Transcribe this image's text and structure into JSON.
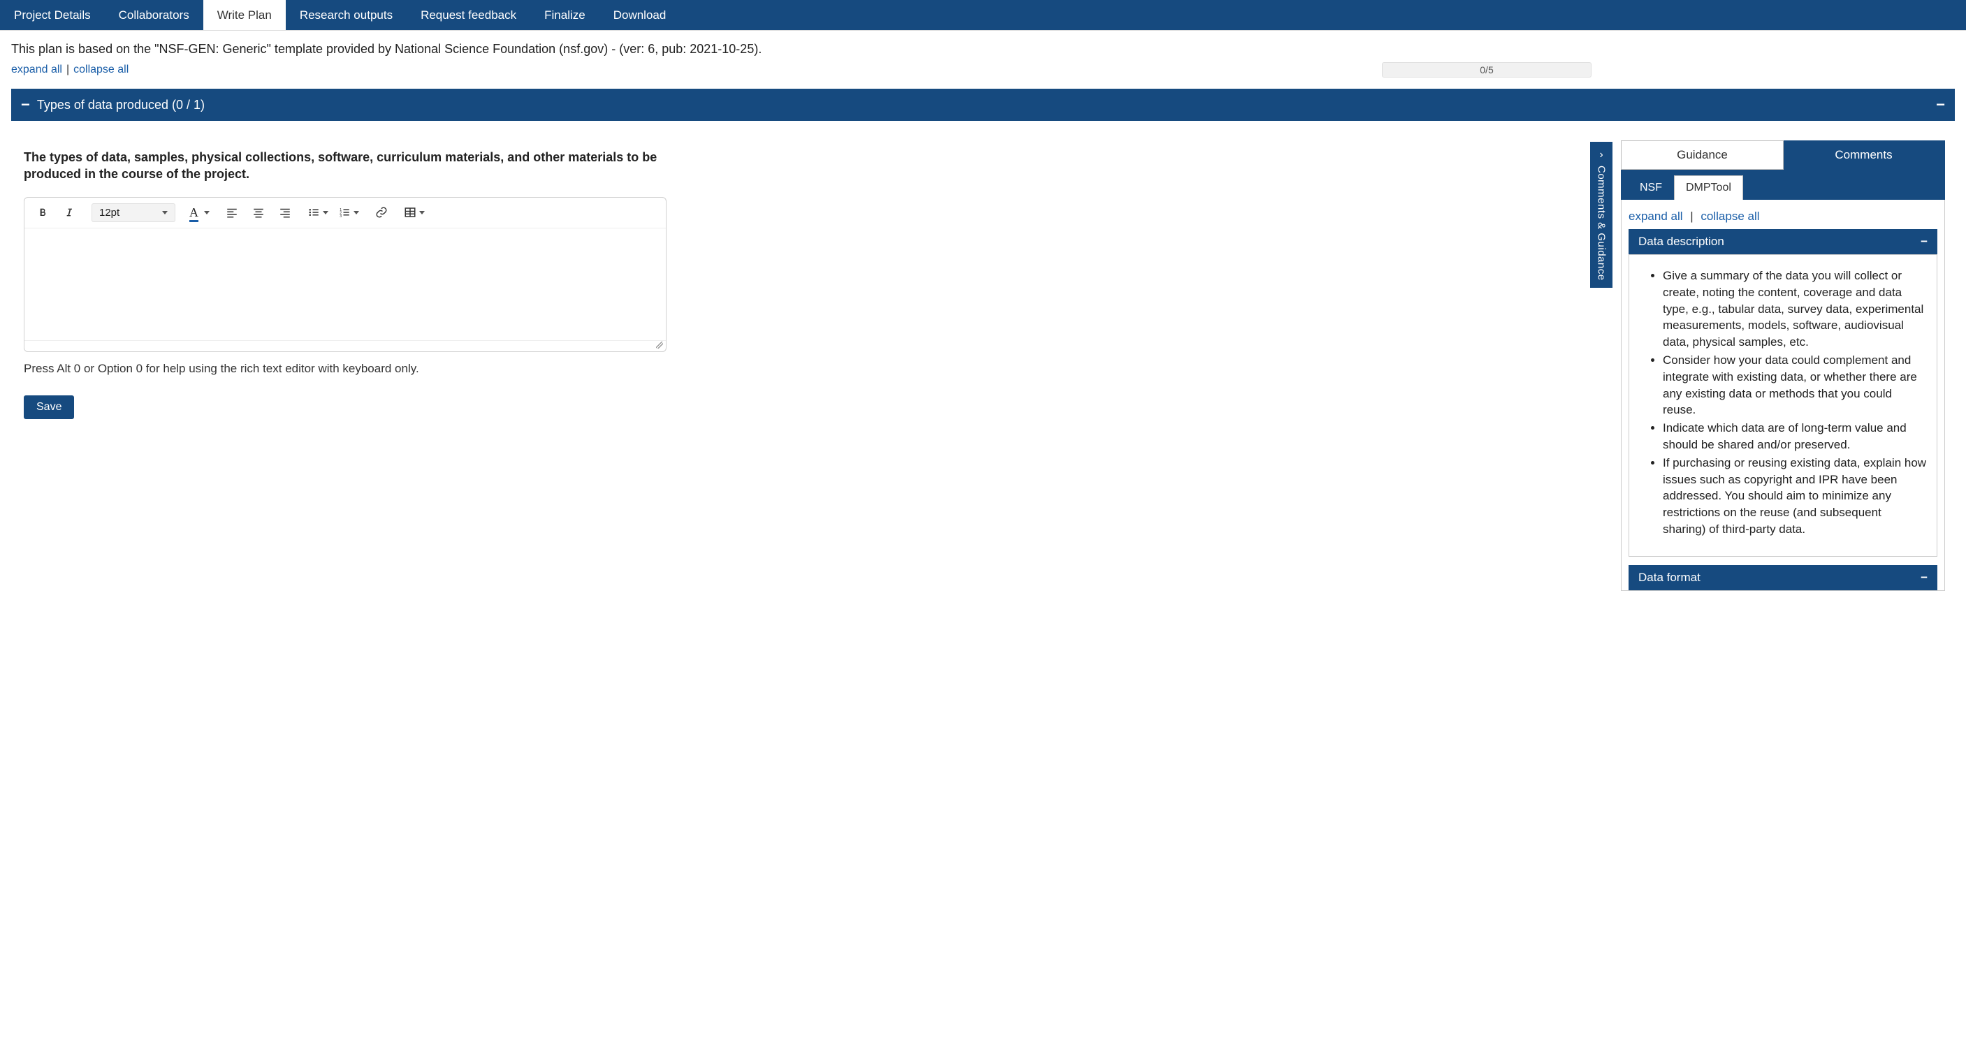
{
  "nav": {
    "tabs": [
      {
        "label": "Project Details",
        "active": false
      },
      {
        "label": "Collaborators",
        "active": false
      },
      {
        "label": "Write Plan",
        "active": true
      },
      {
        "label": "Research outputs",
        "active": false
      },
      {
        "label": "Request feedback",
        "active": false
      },
      {
        "label": "Finalize",
        "active": false
      },
      {
        "label": "Download",
        "active": false
      }
    ]
  },
  "template_note": "This plan is based on the \"NSF-GEN: Generic\" template provided by National Science Foundation (nsf.gov) - (ver: 6, pub: 2021-10-25).",
  "expand_all": "expand all",
  "collapse_all": "collapse all",
  "progress": "0/5",
  "section": {
    "title": "Types of data produced (0 / 1)",
    "question": "The types of data, samples, physical collections, software, curriculum materials, and other materials to be produced in the course of the project.",
    "font_size": "12pt",
    "help_text": "Press Alt 0 or Option 0 for help using the rich text editor with keyboard only.",
    "save_label": "Save"
  },
  "cg_tab_label": "Comments & Guidance",
  "guidance_panel": {
    "tabs": [
      {
        "label": "Guidance",
        "active": true
      },
      {
        "label": "Comments",
        "active": false
      }
    ],
    "sources": [
      {
        "label": "NSF",
        "active": false
      },
      {
        "label": "DMPTool",
        "active": true
      }
    ],
    "expand_all": "expand all",
    "collapse_all": "collapse all",
    "sections": [
      {
        "title": "Data description",
        "open": true,
        "bullets": [
          "Give a summary of the data you will collect or create, noting the content, coverage and data type, e.g., tabular data, survey data, experimental measurements, models, software, audiovisual data, physical samples, etc.",
          "Consider how your data could complement and integrate with existing data, or whether there are any existing data or methods that you could reuse.",
          "Indicate which data are of long-term value and should be shared and/or preserved.",
          "If purchasing or reusing existing data, explain how issues such as copyright and IPR have been addressed. You should aim to minimize any restrictions on the reuse (and subsequent sharing) of third-party data."
        ]
      },
      {
        "title": "Data format",
        "open": false,
        "bullets": []
      }
    ]
  }
}
